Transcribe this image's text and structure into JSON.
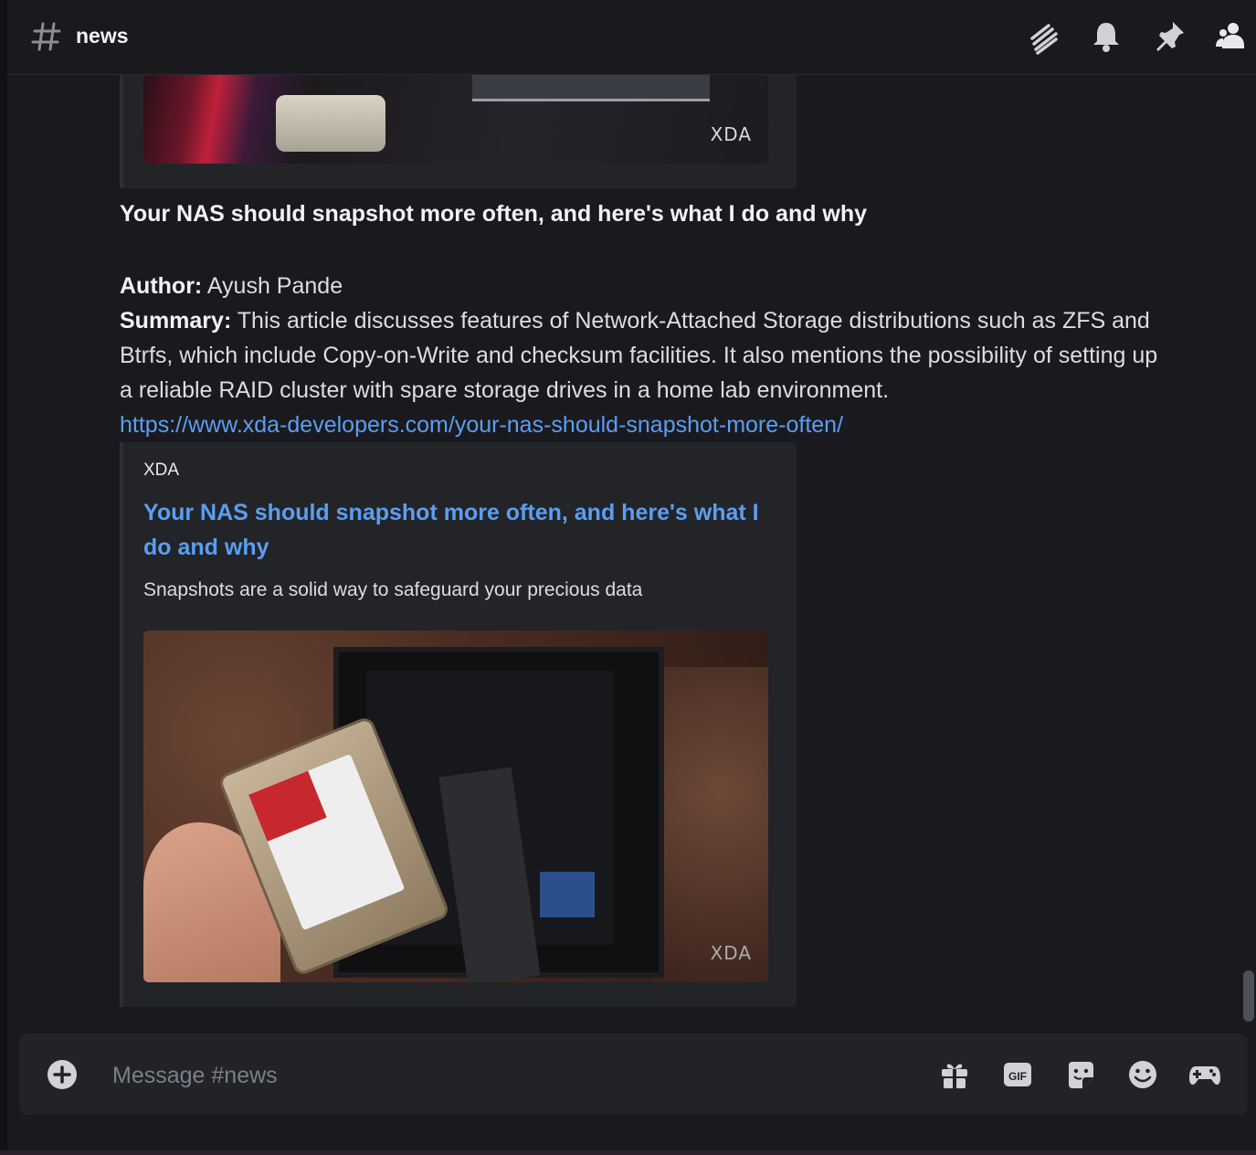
{
  "header": {
    "channel_name": "news",
    "icons": [
      "threads-icon",
      "bell-icon",
      "pin-icon",
      "members-icon"
    ]
  },
  "embed_top": {
    "image_watermark": "XDA"
  },
  "message": {
    "title": "Your NAS should snapshot more often, and here's what I do and why",
    "author_label": "Author:",
    "author": "Ayush Pande",
    "summary_label": "Summary:",
    "summary": "This article discusses features of Network-Attached Storage distributions such as ZFS and Btrfs, which include Copy-on-Write and checksum facilities. It also mentions the possibility of setting up a reliable RAID cluster with spare storage drives in a home lab environment.",
    "link": "https://www.xda-developers.com/your-nas-should-snapshot-more-often/"
  },
  "embed": {
    "provider": "XDA",
    "title": "Your NAS should snapshot more often, and here's what I do and why",
    "description": "Snapshots are a solid way to safeguard your precious data",
    "image_watermark": "XDA"
  },
  "composer": {
    "placeholder": "Message #news",
    "icons": [
      "add-icon",
      "gift-icon",
      "gif-icon",
      "sticker-icon",
      "emoji-icon",
      "game-icon"
    ],
    "gif_label": "GIF"
  }
}
